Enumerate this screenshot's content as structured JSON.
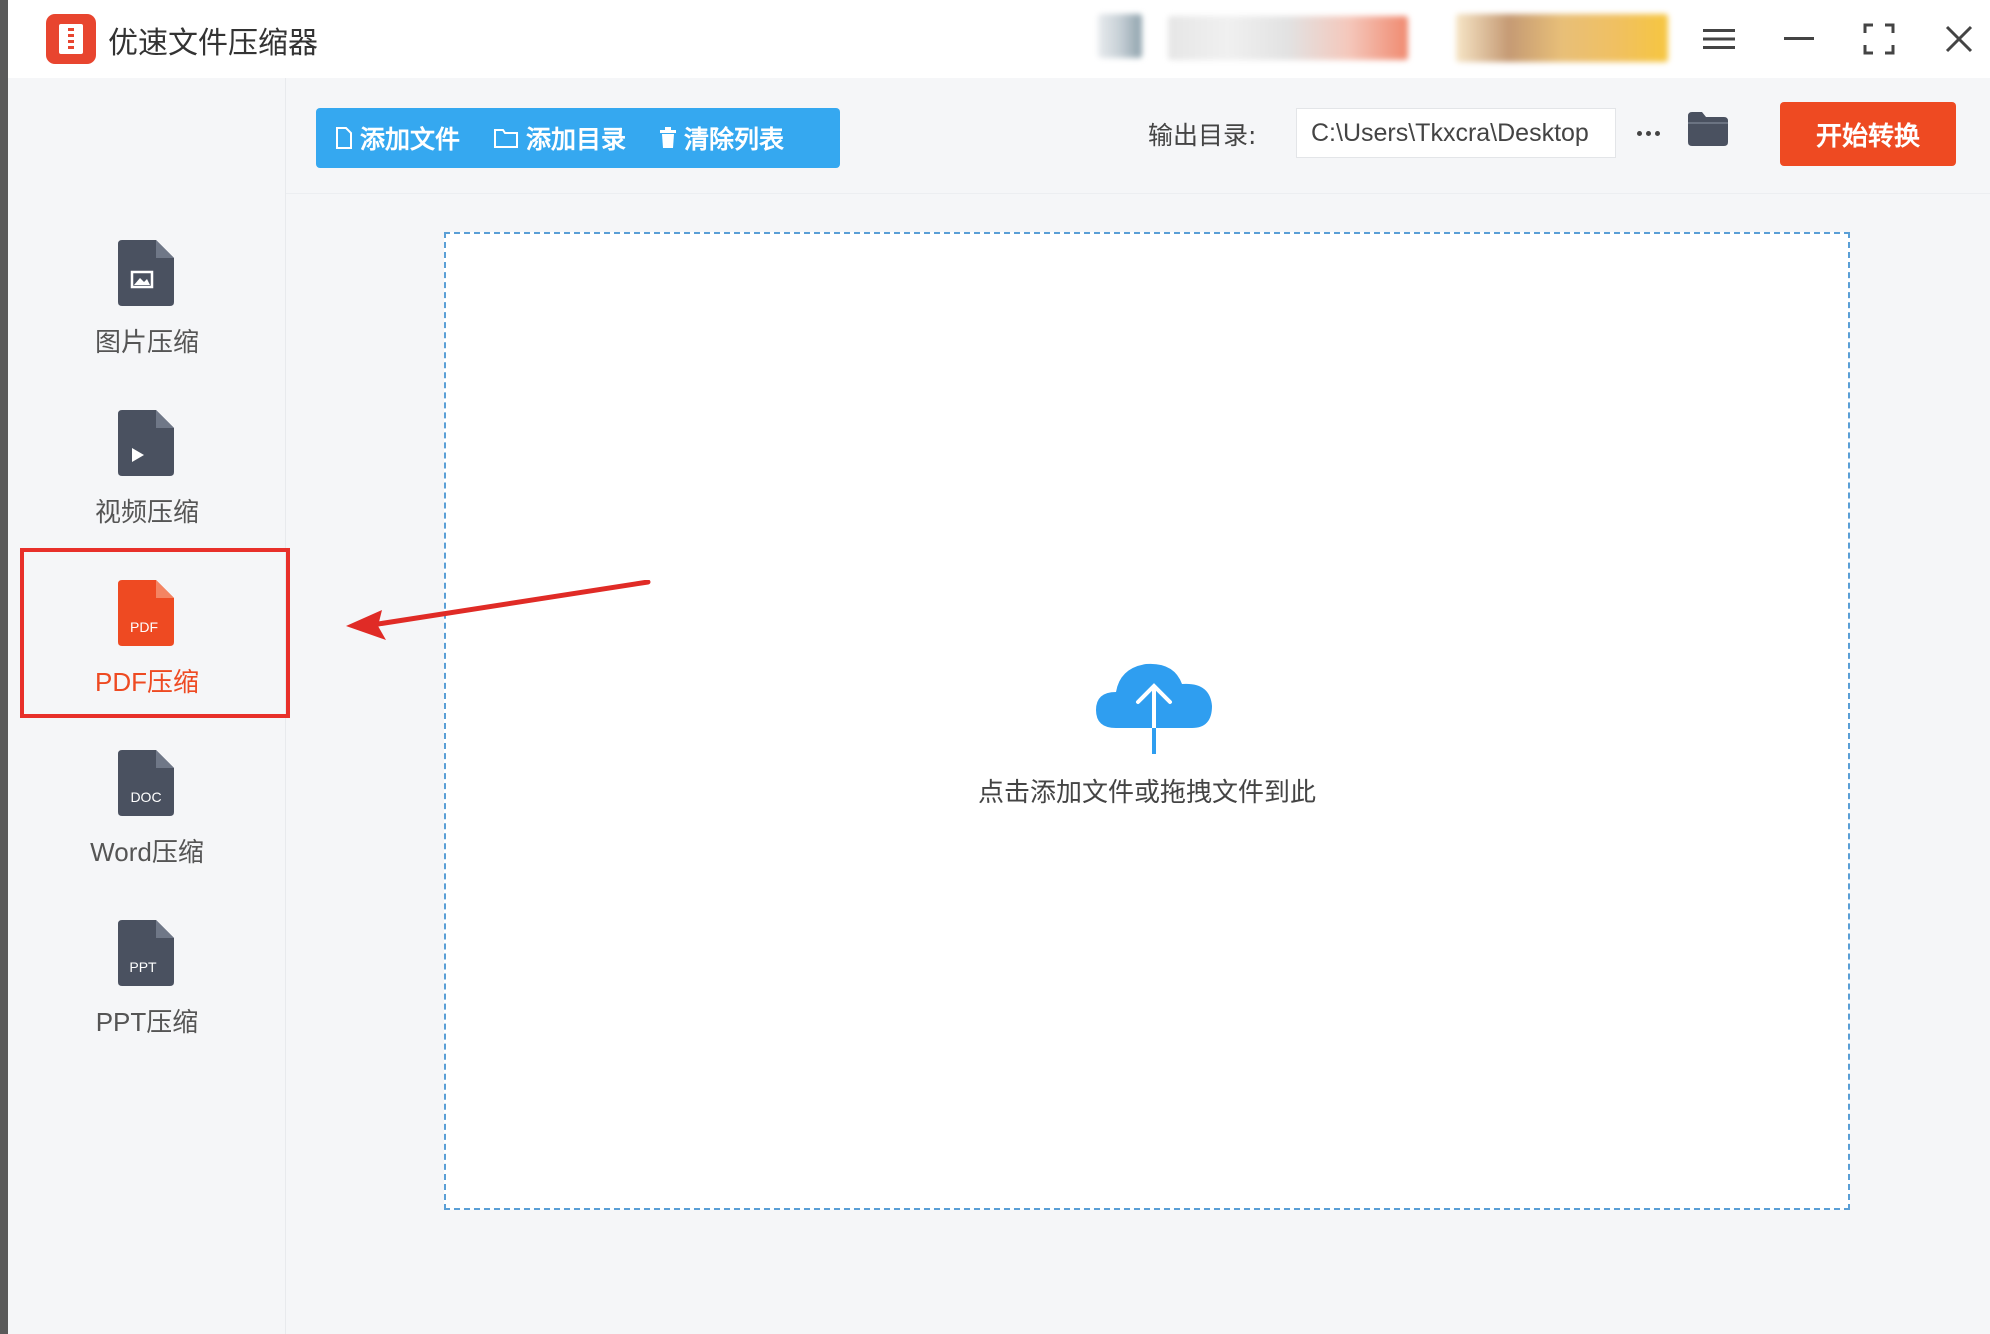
{
  "app": {
    "title": "优速文件压缩器"
  },
  "window_controls": {
    "menu": "menu-icon",
    "minimize": "minimize-icon",
    "maximize": "maximize-icon",
    "close": "close-icon"
  },
  "toolbar": {
    "add_file": "添加文件",
    "add_folder": "添加目录",
    "clear_list": "清除列表",
    "output_label": "输出目录:",
    "output_path": "C:\\Users\\Tkxcra\\Desktop",
    "start": "开始转换"
  },
  "sidebar": {
    "items": [
      {
        "label": "图片压缩",
        "icon": "image-file-icon"
      },
      {
        "label": "视频压缩",
        "icon": "video-file-icon"
      },
      {
        "label": "PDF压缩",
        "icon": "pdf-file-icon",
        "icon_text": "PDF",
        "active": true
      },
      {
        "label": "Word压缩",
        "icon": "doc-file-icon",
        "icon_text": "DOC"
      },
      {
        "label": "PPT压缩",
        "icon": "ppt-file-icon",
        "icon_text": "PPT"
      }
    ]
  },
  "drop_zone": {
    "hint": "点击添加文件或拖拽文件到此"
  },
  "colors": {
    "accent_blue": "#35a8f0",
    "start_orange": "#ee4a22",
    "active_red": "#ee4a22",
    "icon_dark": "#4a5160",
    "highlight_red": "#e8302a"
  }
}
